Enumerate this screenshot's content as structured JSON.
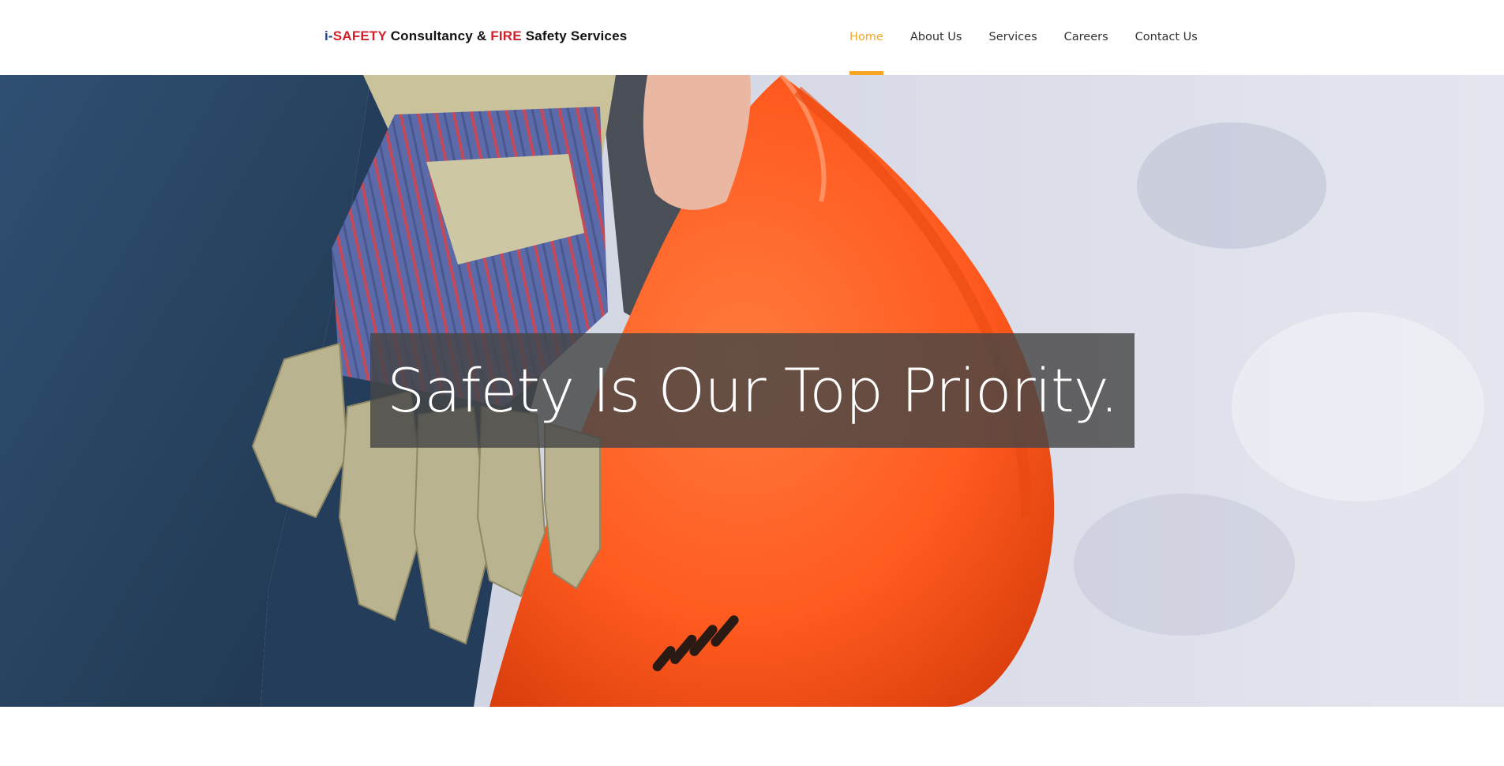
{
  "header": {
    "logo": {
      "prefix": "i-",
      "safety": "SAFETY",
      "middle": " Consultancy & ",
      "fire": "FIRE",
      "suffix": " Safety Services"
    },
    "nav": [
      {
        "label": "Home",
        "active": true
      },
      {
        "label": "About Us",
        "active": false
      },
      {
        "label": "Services",
        "active": false
      },
      {
        "label": "Careers",
        "active": false
      },
      {
        "label": "Contact Us",
        "active": false
      }
    ]
  },
  "hero": {
    "image_description_icon": "worker-hardhat-gloves-photo",
    "tagline": "Safety Is Our Top Priority."
  },
  "colors": {
    "accent": "#f5a623",
    "logo_blue": "#1d3c8c",
    "logo_red": "#d0202a",
    "helmet": "#ff5a1f",
    "denim": "#2b4a6e"
  }
}
